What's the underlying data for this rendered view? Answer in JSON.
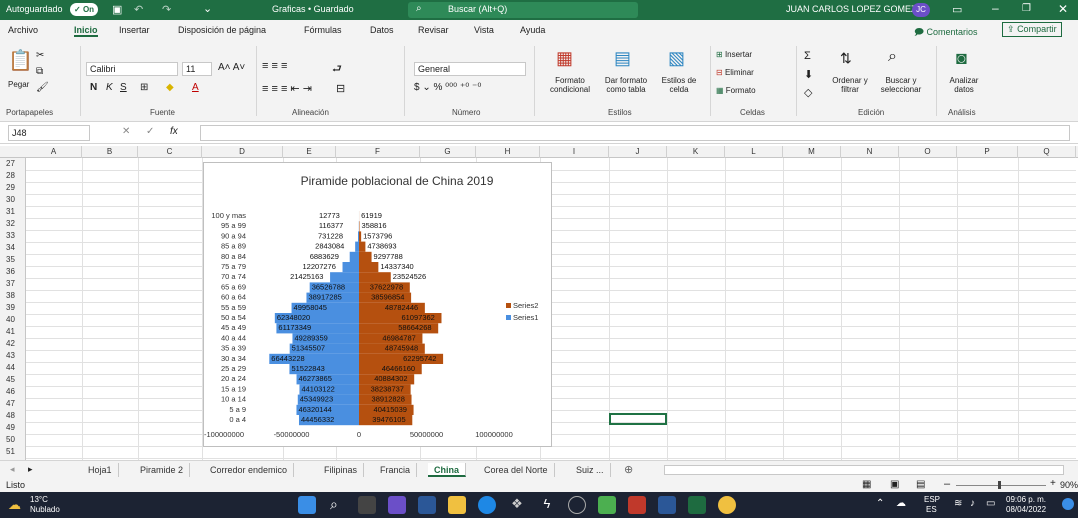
{
  "titlebar": {
    "autosave_label": "Autoguardado",
    "autosave_state": "On",
    "doc_title": "Graficas • Guardado",
    "search_placeholder": "Buscar (Alt+Q)",
    "user_name": "JUAN CARLOS LOPEZ GOMEZ",
    "user_initials": "JC"
  },
  "menu": [
    "Archivo",
    "Inicio",
    "Insertar",
    "Disposición de página",
    "Fórmulas",
    "Datos",
    "Revisar",
    "Vista",
    "Ayuda"
  ],
  "menu_right": {
    "comments": "Comentarios",
    "share": "Compartir"
  },
  "ribbon": {
    "paste": "Pegar",
    "font_name": "Calibri",
    "font_size": "11",
    "number_format": "General",
    "cond_format": "Formato condicional",
    "table_format": "Dar formato como tabla",
    "cell_styles": "Estilos de celda",
    "insert": "Insertar",
    "delete": "Eliminar",
    "format": "Formato",
    "sort_filter": "Ordenar y filtrar",
    "find_select": "Buscar y seleccionar",
    "analyze": "Analizar datos",
    "groups": {
      "clipboard": "Portapapeles",
      "font": "Fuente",
      "alignment": "Alineación",
      "number": "Número",
      "styles": "Estilos",
      "cells": "Celdas",
      "editing": "Edición",
      "analysis": "Análisis"
    }
  },
  "formula_bar": {
    "name_box": "J48",
    "fx": "fx",
    "formula": ""
  },
  "columns": [
    "A",
    "B",
    "C",
    "D",
    "E",
    "F",
    "G",
    "H",
    "I",
    "J",
    "K",
    "L",
    "M",
    "N",
    "O",
    "P",
    "Q"
  ],
  "rows": [
    "27",
    "28",
    "29",
    "30",
    "31",
    "32",
    "33",
    "34",
    "35",
    "36",
    "37",
    "38",
    "39",
    "40",
    "41",
    "42",
    "43",
    "44",
    "45",
    "46",
    "47",
    "48",
    "49",
    "50",
    "51"
  ],
  "sheets": [
    "Hoja1",
    "Piramide 2",
    "Corredor endemico",
    "Filipinas",
    "Francia",
    "China",
    "Corea del Norte",
    "Suiz ..."
  ],
  "active_sheet": "China",
  "status": {
    "left": "Listo",
    "zoom": "90%"
  },
  "taskbar": {
    "temp": "13°C",
    "weather": "Nublado",
    "lang": "ESP",
    "lang2": "ES",
    "time": "09:06 p. m.",
    "date": "08/04/2022"
  },
  "chart_data": {
    "type": "bar",
    "orientation": "horizontal",
    "title": "Piramide poblacional de China 2019",
    "categories": [
      "0 a 4",
      "5 a 9",
      "10 a 14",
      "15 a 19",
      "20 a 24",
      "25 a 29",
      "30 a 34",
      "35 a 39",
      "40 a 44",
      "45 a 49",
      "50 a 54",
      "55 a 59",
      "60 a 64",
      "65 a 69",
      "70 a 74",
      "75 a 79",
      "80 a 84",
      "85 a 89",
      "90 a 94",
      "95 a 99",
      "100 y mas"
    ],
    "series": [
      {
        "name": "Series1",
        "color": "#4a8fe0",
        "values": [
          -44456332,
          -46320144,
          -45349923,
          -44103122,
          -46273865,
          -51522843,
          -66443228,
          -51345507,
          -49289359,
          -61173349,
          -62348020,
          -49958045,
          -38917285,
          -36526788,
          -21425163,
          -12207276,
          -6883629,
          -2843084,
          -731228,
          -116377,
          -12773
        ]
      },
      {
        "name": "Series2",
        "color": "#b5500f",
        "values": [
          39476105,
          40415039,
          38912828,
          38238737,
          40884302,
          46466160,
          62295742,
          48745948,
          46984787,
          58664268,
          61097362,
          48782446,
          38596854,
          37622978,
          23524526,
          14337340,
          9297788,
          4738693,
          1573796,
          358816,
          61919
        ]
      }
    ],
    "data_labels_series1": [
      "44456332",
      "46320144",
      "45349923",
      "44103122",
      "46273865",
      "51522843",
      "66443228",
      "51345507",
      "49289359",
      "61173349",
      "62348020",
      "49958045",
      "38917285",
      "36526788",
      "21425163",
      "12207276",
      "6883629",
      "2843084",
      "731228",
      "116377",
      "12773"
    ],
    "data_labels_series2": [
      "39476105",
      "40415039",
      "38912828",
      "38238737",
      "40884302",
      "46466160",
      "62295742",
      "48745948",
      "46984787",
      "58664268",
      "61097362",
      "48782446",
      "38596854",
      "37622978",
      "23524526",
      "14337340",
      "9297788",
      "4738693",
      "1573796",
      "358816",
      "61919"
    ],
    "xaxis_ticks": [
      "-100000000",
      "-50000000",
      "0",
      "50000000",
      "100000000"
    ],
    "xlim": [
      -100000000,
      100000000
    ],
    "legend_position": "right",
    "legend_order": [
      "Series2",
      "Series1"
    ]
  }
}
